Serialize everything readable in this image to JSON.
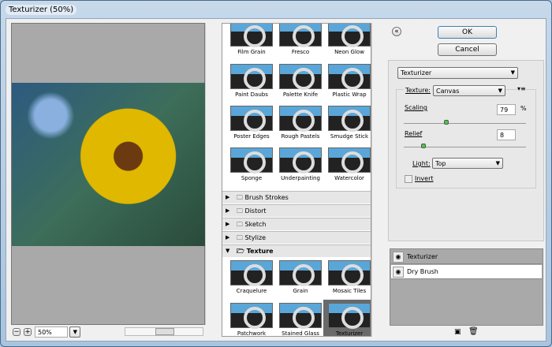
{
  "window": {
    "title": "Texturizer (50%)"
  },
  "preview": {
    "zoom": "50%",
    "zoom_out": "−",
    "zoom_in": "+"
  },
  "gallery": {
    "artistic": [
      {
        "label": "Film Grain"
      },
      {
        "label": "Fresco"
      },
      {
        "label": "Neon Glow"
      },
      {
        "label": "Paint Daubs"
      },
      {
        "label": "Palette Knife"
      },
      {
        "label": "Plastic Wrap"
      },
      {
        "label": "Poster Edges"
      },
      {
        "label": "Rough Pastels"
      },
      {
        "label": "Smudge Stick"
      },
      {
        "label": "Sponge"
      },
      {
        "label": "Underpainting"
      },
      {
        "label": "Watercolor"
      }
    ],
    "categories": [
      {
        "label": "Brush Strokes"
      },
      {
        "label": "Distort"
      },
      {
        "label": "Sketch"
      },
      {
        "label": "Stylize"
      }
    ],
    "texture": {
      "label": "Texture",
      "items": [
        {
          "label": "Craquelure"
        },
        {
          "label": "Grain"
        },
        {
          "label": "Mosaic Tiles"
        },
        {
          "label": "Patchwork"
        },
        {
          "label": "Stained Glass"
        },
        {
          "label": "Texturizer",
          "selected": true
        }
      ]
    }
  },
  "buttons": {
    "ok": "OK",
    "cancel": "Cancel",
    "collapse": "«"
  },
  "settings": {
    "filter": "Texturizer",
    "texture_label": "Texture:",
    "texture": "Canvas",
    "scaling_label": "Scaling",
    "scaling": "79",
    "scaling_unit": "%",
    "scaling_pct": 0.35,
    "relief_label": "Relief",
    "relief": "8",
    "relief_pct": 0.16,
    "light_label": "Light:",
    "light": "Top",
    "invert_label": "Invert",
    "invert": false
  },
  "layers": [
    {
      "name": "Texturizer",
      "selected": true
    },
    {
      "name": "Dry Brush",
      "selected": false
    }
  ],
  "colors": {
    "selected_layer": "#a9a9a9",
    "selected_thumb": "#6a6a6a"
  }
}
